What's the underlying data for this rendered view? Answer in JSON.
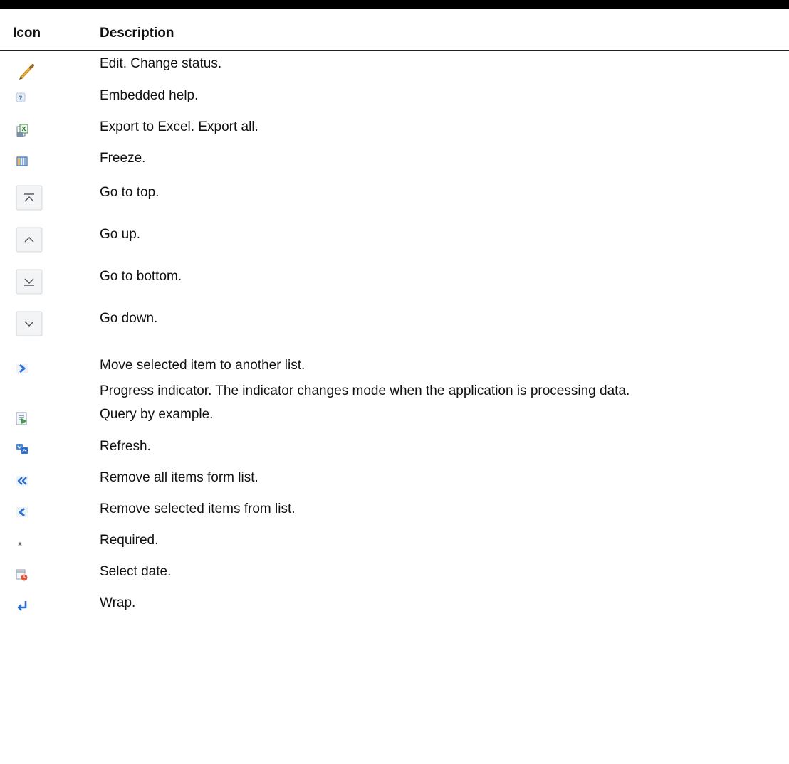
{
  "table": {
    "headers": {
      "icon": "Icon",
      "description": "Description"
    },
    "rows": [
      {
        "icon": "pencil-edit-icon",
        "description": "Edit. Change status."
      },
      {
        "icon": "help-icon",
        "description": "Embedded help."
      },
      {
        "icon": "export-excel-icon",
        "description": "Export to Excel. Export all."
      },
      {
        "icon": "freeze-columns-icon",
        "description": "Freeze."
      },
      {
        "icon": "go-to-top-icon",
        "description": "Go to top."
      },
      {
        "icon": "go-up-icon",
        "description": "Go up."
      },
      {
        "icon": "go-to-bottom-icon",
        "description": "Go to bottom."
      },
      {
        "icon": "go-down-icon",
        "description": "Go down."
      },
      {
        "icon": "move-right-icon",
        "description": "Move selected item to another list."
      },
      {
        "icon": "",
        "description": "Progress indicator. The indicator changes mode when the application is processing data."
      },
      {
        "icon": "query-by-example-icon",
        "description": "Query by example."
      },
      {
        "icon": "refresh-icon",
        "description": "Refresh."
      },
      {
        "icon": "remove-all-icon",
        "description": "Remove all items form list."
      },
      {
        "icon": "remove-selected-icon",
        "description": "Remove selected items from list."
      },
      {
        "icon": "required-asterisk-icon",
        "description": "Required."
      },
      {
        "icon": "select-date-icon",
        "description": "Select date."
      },
      {
        "icon": "wrap-icon",
        "description": "Wrap."
      }
    ]
  }
}
